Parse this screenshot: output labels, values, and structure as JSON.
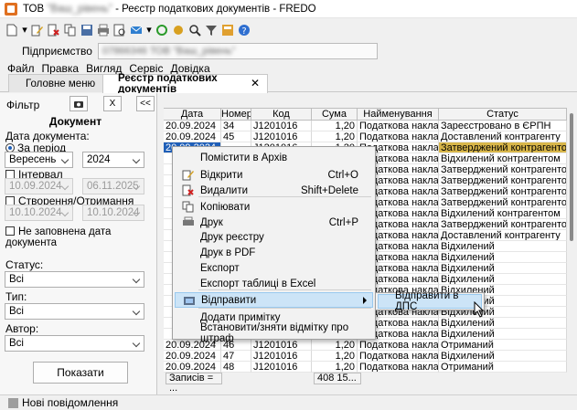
{
  "window": {
    "title_prefix": "ТОВ",
    "title_blur": "\"Ваш_рівень\"",
    "title_suffix": "- Реєстр податкових документів - FREDO"
  },
  "toolbar": {
    "icons": [
      "new-doc-icon",
      "dropdown-icon",
      "edit-icon",
      "delete-icon",
      "copy-icon",
      "save-icon",
      "print-icon",
      "preview-icon",
      "send-icon",
      "dropdown-icon",
      "refresh-icon",
      "sync-icon",
      "search-icon",
      "filter-icon",
      "calculator-icon",
      "help-icon"
    ]
  },
  "enterprise": {
    "label": "Підприємство",
    "value": "07866346 ТОВ \"Ваш_рівень\""
  },
  "menu": [
    "Файл",
    "Правка",
    "Вигляд",
    "Сервіс",
    "Довідка"
  ],
  "tabs": [
    {
      "label": "Головне меню"
    },
    {
      "label": "Реєстр податкових документів",
      "close": "✕"
    }
  ],
  "filter": {
    "title": "Фільтр",
    "close_label": "X",
    "collapse_label": "<<",
    "heading": "Документ",
    "date_label": "Дата документа:",
    "period_label": "За період",
    "month": "Вересень",
    "year": "2024",
    "interval_label": "Інтервал",
    "interval_from": "10.09.2024",
    "interval_to": "06.11.2025",
    "created_label": "Створення/Отримання",
    "created_from": "10.10.2024",
    "created_to": "10.10.2024",
    "no_date_label": "Не заповнена дата документа",
    "status_label": "Статус:",
    "status_value": "Всі",
    "type_label": "Тип:",
    "type_value": "Всі",
    "author_label": "Автор:",
    "author_value": "Всі",
    "show_button": "Показати"
  },
  "grid": {
    "columns": [
      "Дата",
      "Номер",
      "Код",
      "Сума",
      "Найменування",
      "Статус"
    ],
    "rows": [
      [
        "20.09.2024",
        "34",
        "J1201016",
        "1,20",
        "Податкова накла...",
        "Зареєстровано в ЄРПН"
      ],
      [
        "20.09.2024",
        "45",
        "J1201016",
        "1,20",
        "Податкова накла...",
        "Доставлений контрагенту"
      ],
      [
        "20.09.2024",
        "",
        "J1201016",
        "1,20",
        "Податкова накла...",
        "Затверджений контрагентом"
      ],
      [
        "",
        "",
        "",
        "",
        "Податкова накла...",
        "Відхилений контрагентом"
      ],
      [
        "",
        "",
        "",
        "",
        "Податкова накла...",
        "Затверджений контрагентом"
      ],
      [
        "",
        "",
        "",
        "",
        "Податкова накла...",
        "Затверджений контрагентом"
      ],
      [
        "",
        "",
        "",
        "",
        "Податкова накла...",
        "Затверджений контрагентом"
      ],
      [
        "",
        "",
        "",
        "",
        "Податкова накла...",
        "Затверджений контрагентом"
      ],
      [
        "",
        "",
        "",
        "",
        "Податкова накла...",
        "Відхилений контрагентом"
      ],
      [
        "",
        "",
        "",
        "",
        "Податкова накла...",
        "Затверджений контрагентом"
      ],
      [
        "",
        "",
        "",
        "",
        "Податкова накла...",
        "Доставлений контрагенту"
      ],
      [
        "",
        "",
        "",
        "",
        "Податкова накла...",
        "Відхилений"
      ],
      [
        "",
        "",
        "",
        "",
        "Податкова накла...",
        "Відхилений"
      ],
      [
        "",
        "",
        "",
        "",
        "Податкова накла...",
        "Відхилений"
      ],
      [
        "",
        "",
        "",
        "",
        "Податкова накла...",
        "Відхилений"
      ],
      [
        "",
        "",
        "",
        "",
        "Податкова накла...",
        "Відхилений"
      ],
      [
        "",
        "",
        "",
        "",
        "Податкова накла...",
        "Відхилений"
      ],
      [
        "",
        "",
        "",
        "",
        "Податкова накла...",
        "Відхилений"
      ],
      [
        "",
        "",
        "",
        "",
        "Податкова накла...",
        "Відхилений"
      ],
      [
        "",
        "",
        "",
        "",
        "Податкова накла...",
        "Відхилений"
      ],
      [
        "20.09.2024",
        "46",
        "J1201016",
        "1,20",
        "Податкова накла...",
        "Отриманий"
      ],
      [
        "20.09.2024",
        "47",
        "J1201016",
        "1,20",
        "Податкова накла...",
        "Відхилений"
      ],
      [
        "20.09.2024",
        "48",
        "J1201016",
        "1,20",
        "Податкова накла...",
        "Отриманий"
      ]
    ],
    "footer_count": "Записів = ...",
    "footer_sum": "408 15..."
  },
  "context_menu": [
    {
      "label": "Помістити в Архів",
      "icon": "",
      "shortcut": ""
    },
    {
      "label": "Відкрити",
      "icon": "edit-icon",
      "shortcut": "Ctrl+O"
    },
    {
      "label": "Видалити",
      "icon": "delete-icon",
      "shortcut": "Shift+Delete"
    },
    {
      "label": "Копіювати",
      "icon": "copy-icon",
      "shortcut": ""
    },
    {
      "label": "Друк",
      "icon": "print-icon",
      "shortcut": "Ctrl+P"
    },
    {
      "label": "Друк реєстру",
      "icon": "",
      "shortcut": ""
    },
    {
      "label": "Друк в PDF",
      "icon": "",
      "shortcut": ""
    },
    {
      "label": "Експорт",
      "icon": "",
      "shortcut": ""
    },
    {
      "label": "Експорт таблиці в Excel",
      "icon": "",
      "shortcut": ""
    },
    {
      "label": "Відправити",
      "icon": "send-icon",
      "shortcut": ""
    },
    {
      "label": "Додати примітку",
      "icon": "",
      "shortcut": ""
    },
    {
      "label": "Встановити/зняти відмітку про штраф",
      "icon": "",
      "shortcut": ""
    }
  ],
  "submenu": {
    "label": "Відправити в ДПС"
  },
  "status_bar": {
    "label": "Нові повідомлення"
  }
}
